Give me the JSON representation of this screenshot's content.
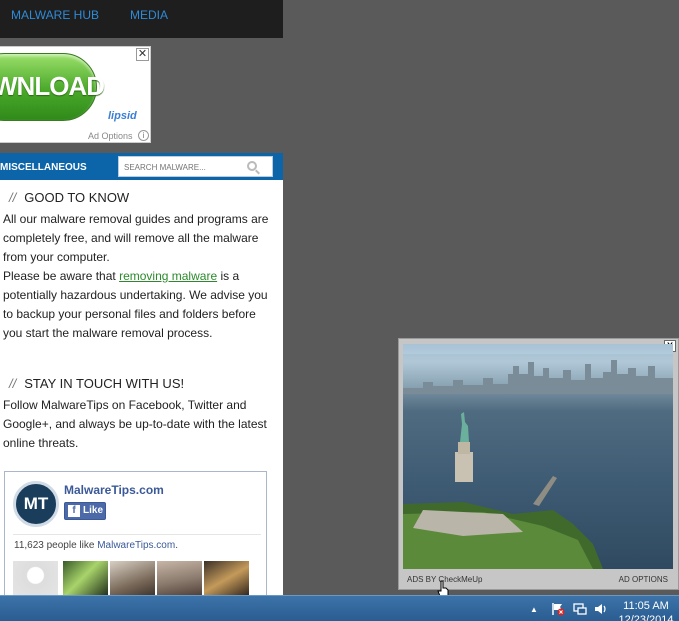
{
  "nav": {
    "items": [
      "MALWARE HUB",
      "MEDIA"
    ]
  },
  "ad": {
    "download_text": "WNLOAD",
    "close": "✕",
    "options_label": "Ad Options",
    "logo_text": "lipsid",
    "info": "i"
  },
  "sidebar": {
    "header_label": "MISCELLANEOUS",
    "search_placeholder": "SEARCH MALWARE..."
  },
  "good_to_know": {
    "slashes": "//",
    "title": "GOOD TO KNOW",
    "para_1": "All our malware removal guides and programs are completely free, and will remove all the malware from your computer.",
    "para_2a": "Please be aware that ",
    "link": "removing malware",
    "para_2b": " is a potentially hazardous undertaking. We advise you to backup your personal files and folders before you start the malware removal process."
  },
  "stay_in_touch": {
    "slashes": "//",
    "title": "STAY IN TOUCH WITH US!",
    "para": "Follow MalwareTips on Facebook, Twitter and Google+, and always be up-to-date with the latest online threats."
  },
  "facebook": {
    "logo_text": "MT",
    "page_name": "MalwareTips.com",
    "like_icon": "f",
    "like_label": "Like",
    "count_text": "11,623 people like ",
    "count_link": "MalwareTips.com",
    "count_suffix": "."
  },
  "video_ad": {
    "close": "X",
    "ads_by": "ADS BY CheckMeUp",
    "ad_options": "AD OPTIONS"
  },
  "taskbar": {
    "tray_arrow": "▲",
    "time": "11:05 AM",
    "date": "12/23/2014"
  }
}
